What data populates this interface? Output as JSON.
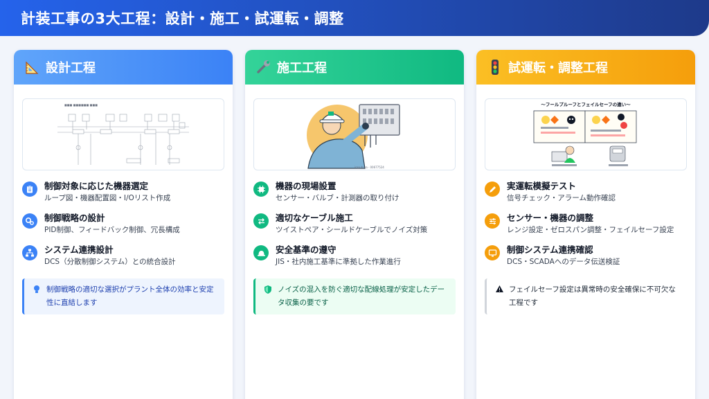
{
  "page": {
    "title": "計装工事の3大工程：設計・施工・試運転・調整"
  },
  "cards": [
    {
      "icon": "triangle-ruler-icon",
      "title": "設計工程",
      "items": [
        {
          "icon": "clipboard-icon",
          "title": "制御対象に応じた機器選定",
          "desc": "ループ図・機器配置図・I/Oリスト作成"
        },
        {
          "icon": "gears-icon",
          "title": "制御戦略の設計",
          "desc": "PID制御、フィードバック制御、冗長構成"
        },
        {
          "icon": "network-icon",
          "title": "システム連携設計",
          "desc": "DCS（分散制御システム）との統合設計"
        }
      ],
      "note": {
        "icon": "lightbulb-icon",
        "text": "制御戦略の適切な選択がプラント全体の効率と安定性に直結します"
      }
    },
    {
      "icon": "wrench-icon",
      "title": "施工工程",
      "illus_caption": "irasutoya · 00677524",
      "items": [
        {
          "icon": "microchip-icon",
          "title": "機器の現場設置",
          "desc": "センサー・バルブ・計測器の取り付け"
        },
        {
          "icon": "swap-arrows-icon",
          "title": "適切なケーブル施工",
          "desc": "ツイストペア・シールドケーブルでノイズ対策"
        },
        {
          "icon": "hard-hat-icon",
          "title": "安全基準の遵守",
          "desc": "JIS・社内施工基準に準拠した作業進行"
        }
      ],
      "note": {
        "icon": "shield-icon",
        "text": "ノイズの混入を防ぐ適切な配線処理が安定したデータ収集の要です"
      }
    },
    {
      "icon": "traffic-light-icon",
      "title": "試運転・調整工程",
      "illus_title": "〜フールプルーフとフェイルセーフの違い〜",
      "items": [
        {
          "icon": "pen-icon",
          "title": "実運転模擬テスト",
          "desc": "信号チェック・アラーム動作確認"
        },
        {
          "icon": "sliders-icon",
          "title": "センサー・機器の調整",
          "desc": "レンジ設定・ゼロスパン調整・フェイルセーフ設定"
        },
        {
          "icon": "monitor-icon",
          "title": "制御システム連携確認",
          "desc": "DCS・SCADAへのデータ伝送検証"
        }
      ],
      "note": {
        "icon": "warning-icon",
        "text": "フェイルセーフ設定は異常時の安全確保に不可欠な工程です"
      }
    }
  ],
  "colors": {
    "header": "#2563eb",
    "design": "#3b82f6",
    "construction": "#10b981",
    "commissioning": "#f59e0b"
  }
}
